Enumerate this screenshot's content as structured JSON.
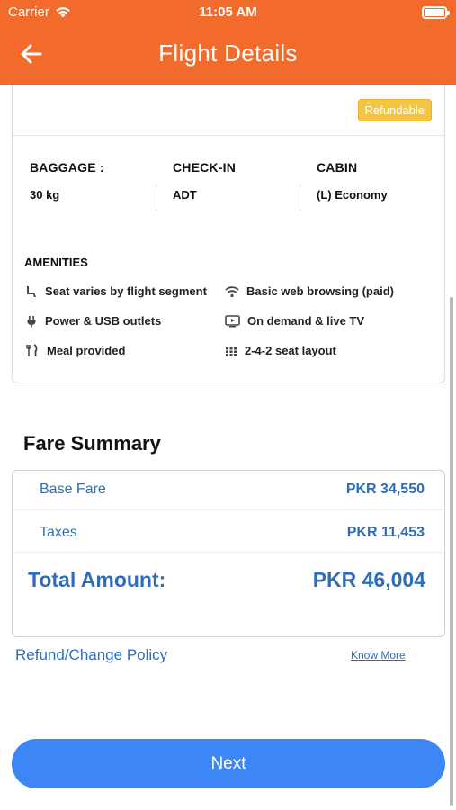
{
  "status_bar": {
    "carrier": "Carrier",
    "time": "11:05 AM"
  },
  "header": {
    "title": "Flight Details"
  },
  "badge": {
    "refundable": "Refundable"
  },
  "details": {
    "baggage_label": "BAGGAGE :",
    "baggage_value": "30 kg",
    "checkin_label": "CHECK-IN",
    "checkin_value": "ADT",
    "cabin_label": "CABIN",
    "cabin_value": "(L) Economy"
  },
  "amenities": {
    "title": "AMENITIES",
    "items": [
      {
        "label": "Seat varies by flight segment",
        "icon": "seat-icon"
      },
      {
        "label": "Basic web browsing (paid)",
        "icon": "wifi-icon"
      },
      {
        "label": "Power & USB outlets",
        "icon": "plug-icon"
      },
      {
        "label": "On demand & live TV",
        "icon": "tv-icon"
      },
      {
        "label": "Meal provided",
        "icon": "meal-icon"
      },
      {
        "label": "2-4-2 seat layout",
        "icon": "seat-layout-icon"
      }
    ]
  },
  "fare": {
    "title": "Fare Summary",
    "base_label": "Base Fare",
    "base_amount": "PKR 34,550",
    "taxes_label": "Taxes",
    "taxes_amount": "PKR 11,453",
    "total_label": "Total Amount:",
    "total_amount": "PKR 46,004"
  },
  "policy": {
    "label": "Refund/Change Policy",
    "link": "Know More"
  },
  "actions": {
    "next": "Next"
  },
  "colors": {
    "header": "#f26b2b",
    "accent_blue": "#2f6db8",
    "button": "#3d86f5",
    "badge": "#f4c542"
  }
}
